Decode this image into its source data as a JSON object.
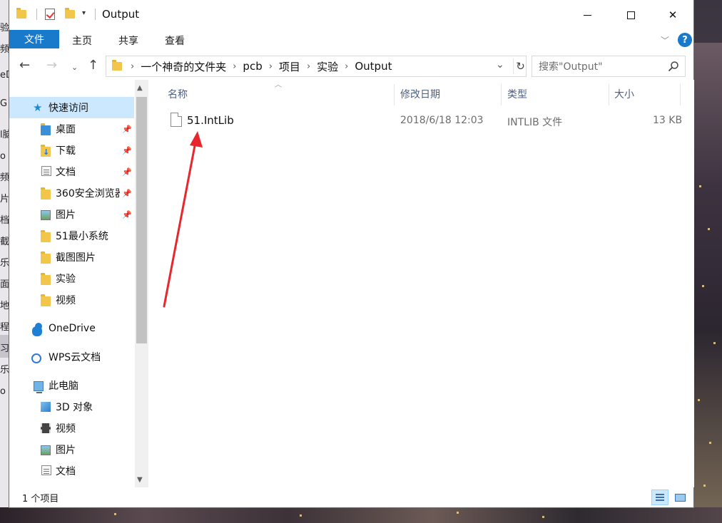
{
  "window": {
    "title": "Output",
    "qa_dropdown": "▾",
    "minimize": "—",
    "maximize": "☐",
    "close": "✕"
  },
  "ribbon": {
    "tabs": [
      "文件",
      "主页",
      "共享",
      "查看"
    ],
    "help": "?"
  },
  "address": {
    "breadcrumbs": [
      "一个神奇的文件夹",
      "pcb",
      "项目",
      "实验",
      "Output"
    ]
  },
  "search": {
    "placeholder": "搜索\"Output\""
  },
  "nav": {
    "items": [
      {
        "label": "快速访问",
        "icon": "star-icon"
      },
      {
        "label": "桌面",
        "icon": "desktop-folder-icon",
        "pinned": true
      },
      {
        "label": "下载",
        "icon": "download-folder-icon",
        "pinned": true
      },
      {
        "label": "文档",
        "icon": "documents-folder-icon",
        "pinned": true
      },
      {
        "label": "360安全浏览器",
        "icon": "folder-icon",
        "pinned": true
      },
      {
        "label": "图片",
        "icon": "pictures-folder-icon",
        "pinned": true
      },
      {
        "label": "51最小系统",
        "icon": "folder-icon"
      },
      {
        "label": "截图图片",
        "icon": "folder-icon"
      },
      {
        "label": "实验",
        "icon": "folder-icon"
      },
      {
        "label": "视频",
        "icon": "folder-icon"
      },
      {
        "label": "OneDrive",
        "icon": "onedrive-cloud-icon"
      },
      {
        "label": "WPS云文档",
        "icon": "wps-cloud-icon"
      },
      {
        "label": "此电脑",
        "icon": "pc-icon"
      },
      {
        "label": "3D 对象",
        "icon": "3d-objects-icon"
      },
      {
        "label": "视频",
        "icon": "videos-folder-icon"
      },
      {
        "label": "图片",
        "icon": "pictures-folder-icon"
      },
      {
        "label": "文档",
        "icon": "documents-folder-icon"
      }
    ]
  },
  "columns": {
    "name": "名称",
    "modified": "修改日期",
    "type": "类型",
    "size": "大小"
  },
  "files": [
    {
      "name": "51.IntLib",
      "modified": "2018/6/18 12:03",
      "type": "INTLIB 文件",
      "size": "13 KB"
    }
  ],
  "status": {
    "count": "1 个项目"
  },
  "colors": {
    "accent": "#1979ca",
    "selection": "#cce8ff",
    "arrow": "#e8262b"
  },
  "desktop_edge_text": [
    "验",
    "频",
    "eD",
    "G z",
    "l脑",
    "o 文",
    "频",
    "片",
    "档",
    "截",
    "乐",
    "面",
    "地",
    "程",
    "习",
    "乐",
    "o 罗"
  ]
}
